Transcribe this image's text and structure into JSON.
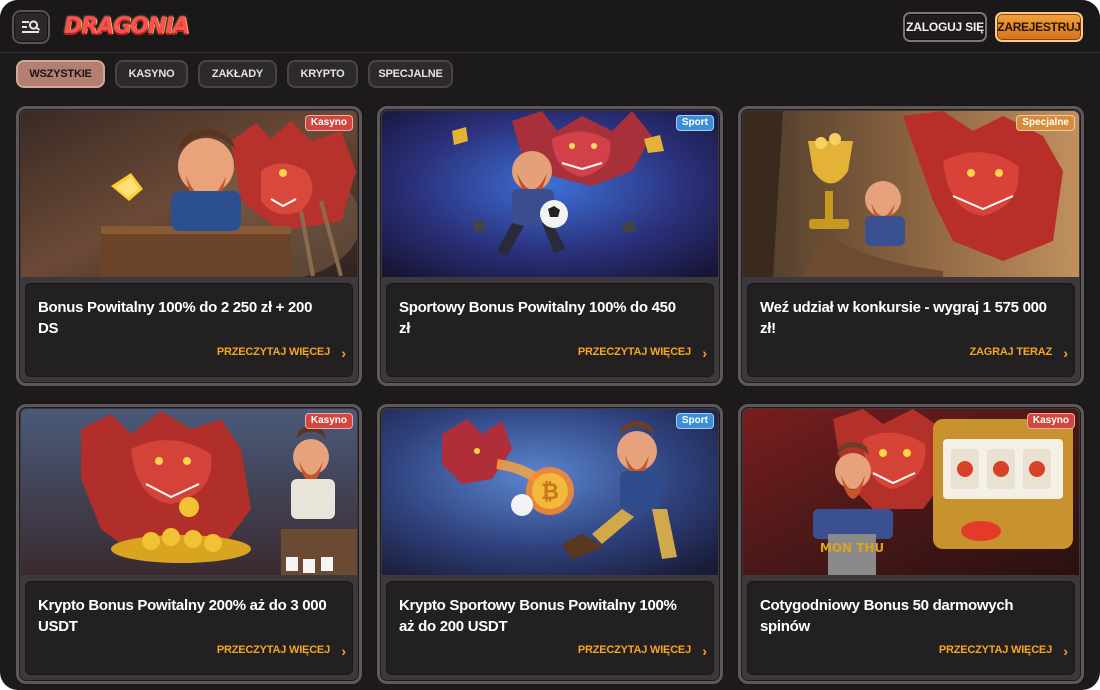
{
  "header": {
    "logo_text": "DRAGONIA",
    "login_label": "ZALOGUJ SIĘ",
    "register_label": "ZAREJESTRUJ",
    "menu_icon": "menu-search-icon"
  },
  "tabs": [
    {
      "label": "WSZYSTKIE",
      "active": true
    },
    {
      "label": "KASYNO",
      "active": false
    },
    {
      "label": "ZAKŁADY",
      "active": false
    },
    {
      "label": "KRYPTO",
      "active": false
    },
    {
      "label": "SPECJALNE",
      "active": false
    }
  ],
  "cards": [
    {
      "badge": "Kasyno",
      "title": "Bonus Powitalny 100% do 2 250 zł + 200 DS",
      "cta": "PRZECZYTAJ WIĘCEJ"
    },
    {
      "badge": "Sport",
      "title": "Sportowy Bonus Powitalny 100% do 450 zł",
      "cta": "PRZECZYTAJ WIĘCEJ"
    },
    {
      "badge": "Specjalne",
      "title": "Weź udział w konkursie - wygraj 1 575 000 zł!",
      "cta": "ZAGRAJ TERAZ"
    },
    {
      "badge": "Kasyno",
      "title": "Krypto Bonus Powitalny 200% aż do 3 000 USDT",
      "cta": "PRZECZYTAJ WIĘCEJ"
    },
    {
      "badge": "Sport",
      "title": "Krypto Sportowy Bonus Powitalny 100% aż do 200 USDT",
      "cta": "PRZECZYTAJ WIĘCEJ"
    },
    {
      "badge": "Kasyno",
      "title": "Cotygodniowy Bonus 50 darmowych spinów",
      "cta": "PRZECZYTAJ WIĘCEJ"
    }
  ],
  "illustration_text": {
    "slot_sign": "MON THU"
  },
  "colors": {
    "accent": "#f5a524",
    "casino_badge": "#d2463d",
    "sport_badge": "#3b8fd8",
    "special_badge": "#d88b3a"
  }
}
